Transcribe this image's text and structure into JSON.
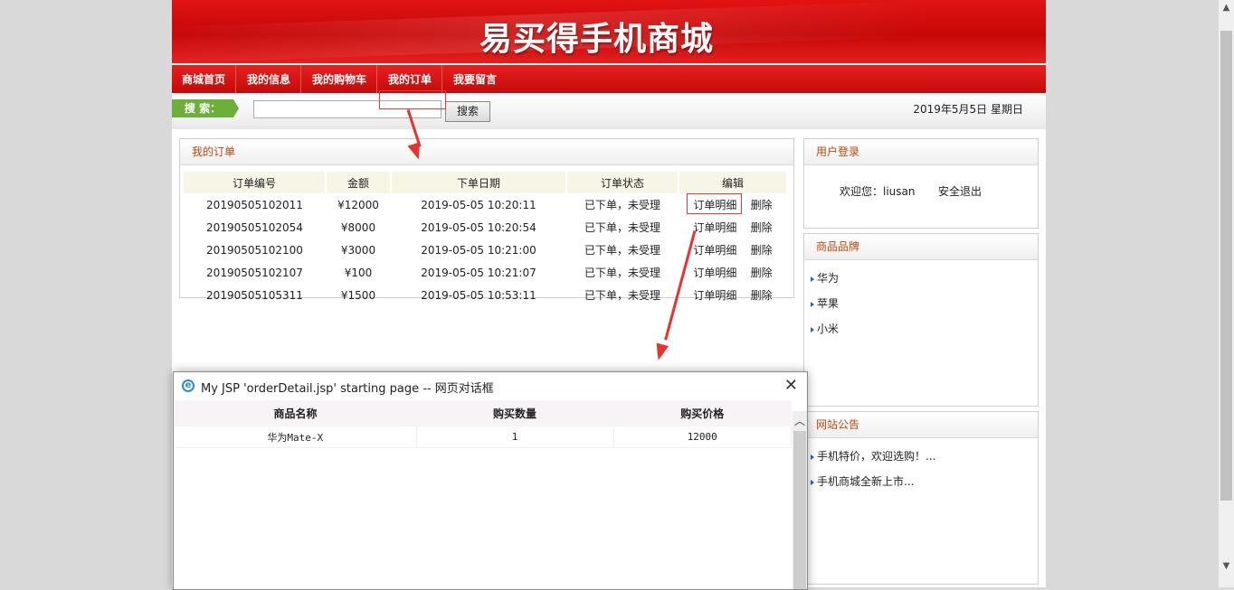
{
  "banner": {
    "title": "易买得手机商城"
  },
  "nav": {
    "items": [
      "商城首页",
      "我的信息",
      "我的购物车",
      "我的订单",
      "我要留言"
    ]
  },
  "search": {
    "label": "搜 索：",
    "value": "",
    "button": "搜索"
  },
  "date": "2019年5月5日 星期日",
  "orders": {
    "title": "我的订单",
    "columns": [
      "订单编号",
      "金额",
      "下单日期",
      "订单状态",
      "编辑"
    ],
    "rows": [
      {
        "id": "20190505102011",
        "amount": "¥12000",
        "date": "2019-05-05 10:20:11",
        "status": "已下单，未受理",
        "detail": "订单明细",
        "delete": "删除"
      },
      {
        "id": "20190505102054",
        "amount": "¥8000",
        "date": "2019-05-05 10:20:54",
        "status": "已下单，未受理",
        "detail": "订单明细",
        "delete": "删除"
      },
      {
        "id": "20190505102100",
        "amount": "¥3000",
        "date": "2019-05-05 10:21:00",
        "status": "已下单，未受理",
        "detail": "订单明细",
        "delete": "删除"
      },
      {
        "id": "20190505102107",
        "amount": "¥100",
        "date": "2019-05-05 10:21:07",
        "status": "已下单，未受理",
        "detail": "订单明细",
        "delete": "删除"
      },
      {
        "id": "20190505105311",
        "amount": "¥1500",
        "date": "2019-05-05 10:53:11",
        "status": "已下单，未受理",
        "detail": "订单明细",
        "delete": "删除"
      }
    ]
  },
  "login": {
    "title": "用户登录",
    "welcome": "欢迎您：liusan",
    "logout": "安全退出"
  },
  "brands": {
    "title": "商品品牌",
    "items": [
      "华为",
      "苹果",
      "小米"
    ]
  },
  "notice": {
    "title": "网站公告",
    "items": [
      "手机特价，欢迎选购！...",
      "手机商城全新上市..."
    ]
  },
  "dialog": {
    "title": "My JSP 'orderDetail.jsp' starting page -- 网页对话框",
    "close": "✕",
    "columns": [
      "商品名称",
      "购买数量",
      "购买价格"
    ],
    "rows": [
      {
        "name": "华为Mate-X",
        "qty": "1",
        "price": "12000"
      }
    ]
  },
  "colors": {
    "nav_red": "#d11414",
    "accent_green": "#6cb03a",
    "panel_title": "#c0460f",
    "annotation": "#e8322b"
  }
}
